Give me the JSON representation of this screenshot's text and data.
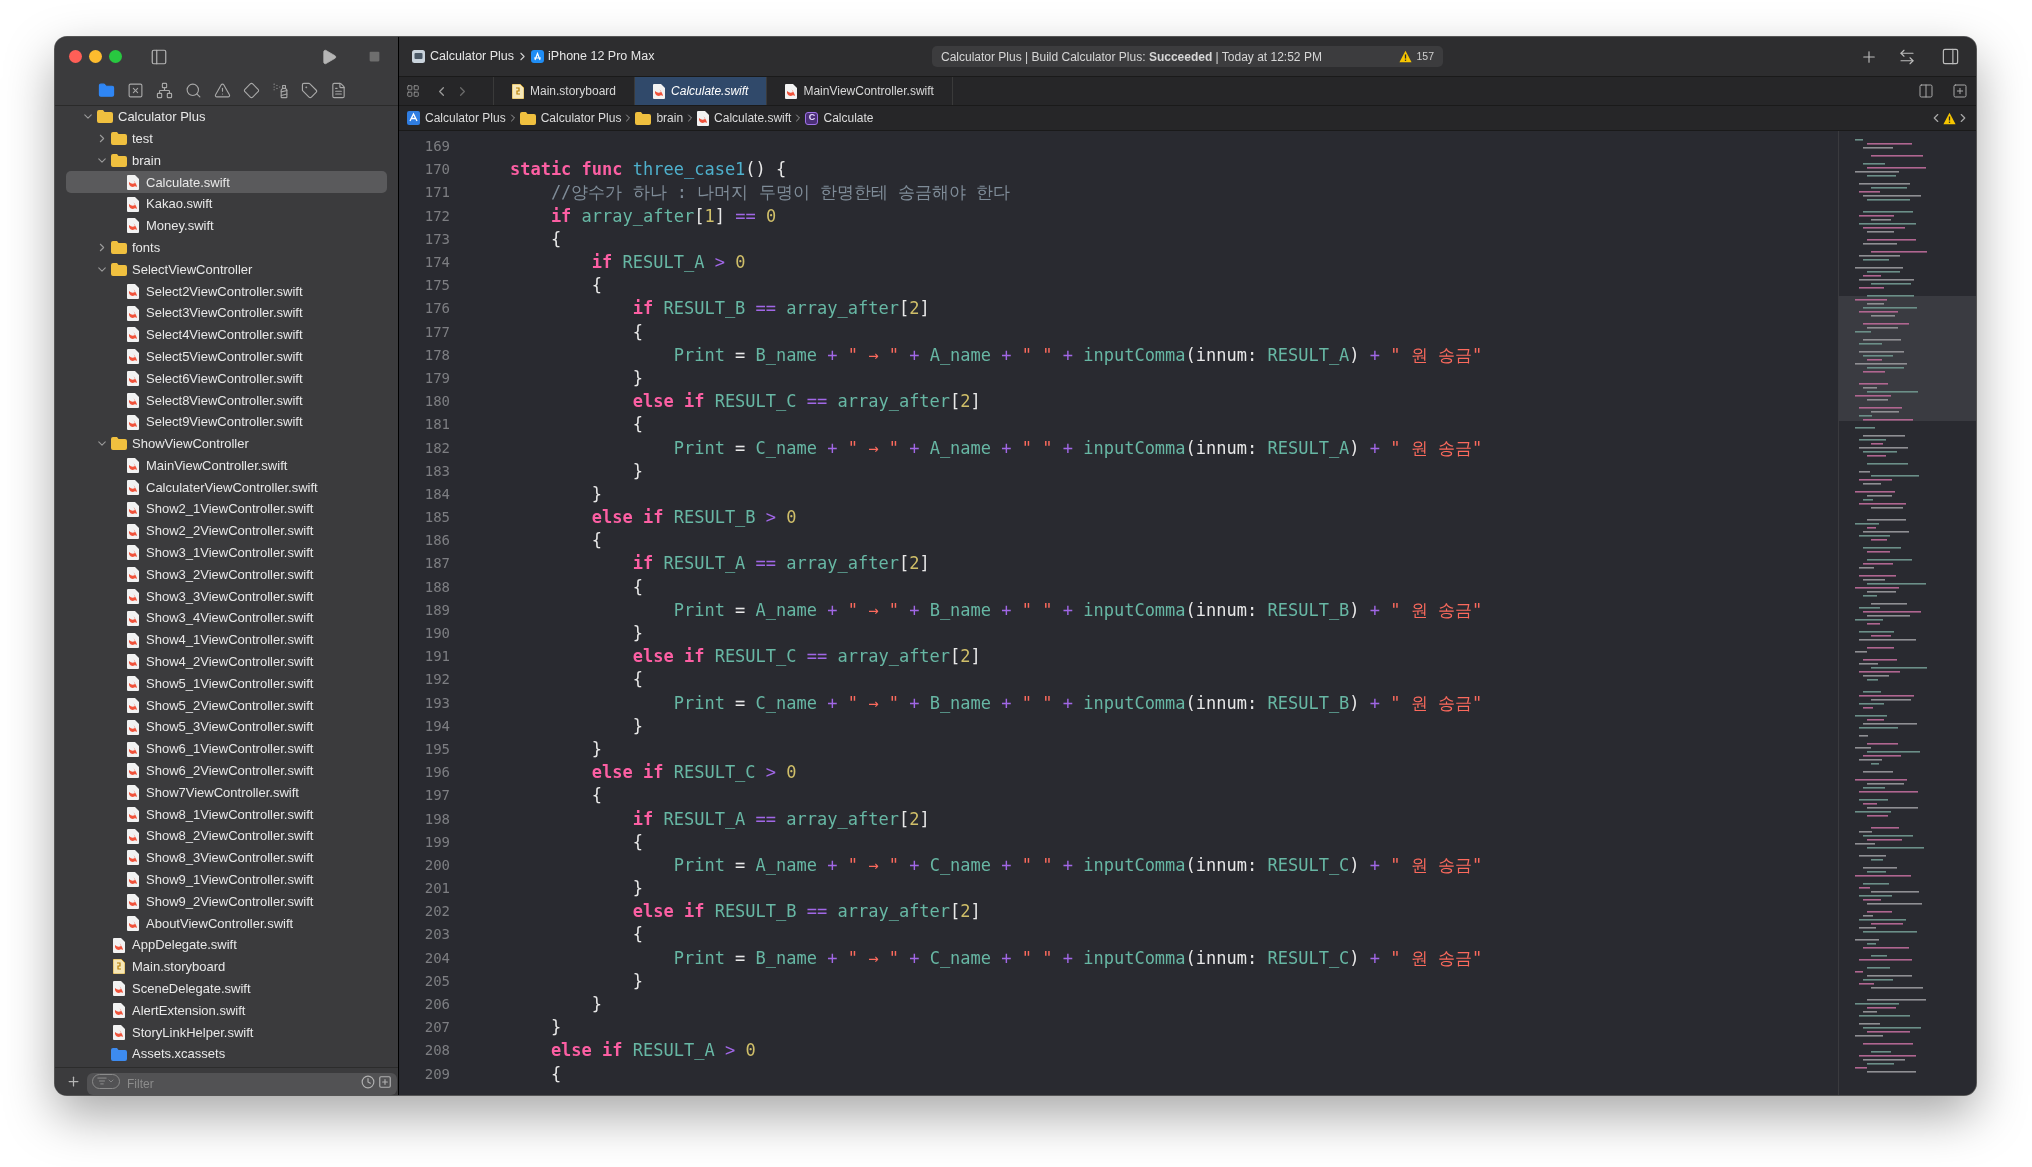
{
  "toolbar": {
    "scheme": "Calculator Plus",
    "destination": "iPhone 12 Pro Max",
    "activity": {
      "status": "Calculator Plus | Build Calculator Plus: **Succeeded** | Today at 12:52 PM",
      "warnings": "157"
    }
  },
  "navigator_tabs": [
    {
      "kind": "project",
      "selected": true
    },
    {
      "kind": "source_control",
      "selected": false
    },
    {
      "kind": "symbols",
      "selected": false
    },
    {
      "kind": "find",
      "selected": false
    },
    {
      "kind": "issues",
      "selected": false
    },
    {
      "kind": "tests",
      "selected": false
    },
    {
      "kind": "debug",
      "selected": false
    },
    {
      "kind": "breakpoints",
      "selected": false
    },
    {
      "kind": "reports",
      "selected": false
    }
  ],
  "sidebar": {
    "tree": [
      {
        "name": "Calculator Plus",
        "kind": "folder",
        "expanded": true,
        "selected": false,
        "children": [
          {
            "name": "test",
            "kind": "folder",
            "expanded": false,
            "selected": false
          },
          {
            "name": "brain",
            "kind": "folder",
            "expanded": true,
            "selected": false,
            "children": [
              {
                "name": "Calculate.swift",
                "kind": "swift",
                "selected": true
              },
              {
                "name": "Kakao.swift",
                "kind": "swift",
                "selected": false
              },
              {
                "name": "Money.swift",
                "kind": "swift",
                "selected": false
              }
            ]
          },
          {
            "name": "fonts",
            "kind": "folder",
            "expanded": false,
            "selected": false
          },
          {
            "name": "SelectViewController",
            "kind": "folder",
            "expanded": true,
            "selected": false,
            "children": [
              {
                "name": "Select2ViewController.swift",
                "kind": "swift",
                "selected": false
              },
              {
                "name": "Select3ViewController.swift",
                "kind": "swift",
                "selected": false
              },
              {
                "name": "Select4ViewController.swift",
                "kind": "swift",
                "selected": false
              },
              {
                "name": "Select5ViewController.swift",
                "kind": "swift",
                "selected": false
              },
              {
                "name": "Select6ViewController.swift",
                "kind": "swift",
                "selected": false
              },
              {
                "name": "Select8ViewController.swift",
                "kind": "swift",
                "selected": false
              },
              {
                "name": "Select9ViewController.swift",
                "kind": "swift",
                "selected": false
              }
            ]
          },
          {
            "name": "ShowViewController",
            "kind": "folder",
            "expanded": true,
            "selected": false,
            "children": [
              {
                "name": "MainViewController.swift",
                "kind": "swift",
                "selected": false
              },
              {
                "name": "CalculaterViewController.swift",
                "kind": "swift",
                "selected": false
              },
              {
                "name": "Show2_1ViewController.swift",
                "kind": "swift",
                "selected": false
              },
              {
                "name": "Show2_2ViewController.swift",
                "kind": "swift",
                "selected": false
              },
              {
                "name": "Show3_1ViewController.swift",
                "kind": "swift",
                "selected": false
              },
              {
                "name": "Show3_2ViewController.swift",
                "kind": "swift",
                "selected": false
              },
              {
                "name": "Show3_3ViewController.swift",
                "kind": "swift",
                "selected": false
              },
              {
                "name": "Show3_4ViewController.swift",
                "kind": "swift",
                "selected": false
              },
              {
                "name": "Show4_1ViewController.swift",
                "kind": "swift",
                "selected": false
              },
              {
                "name": "Show4_2ViewController.swift",
                "kind": "swift",
                "selected": false
              },
              {
                "name": "Show5_1ViewController.swift",
                "kind": "swift",
                "selected": false
              },
              {
                "name": "Show5_2ViewController.swift",
                "kind": "swift",
                "selected": false
              },
              {
                "name": "Show5_3ViewController.swift",
                "kind": "swift",
                "selected": false
              },
              {
                "name": "Show6_1ViewController.swift",
                "kind": "swift",
                "selected": false
              },
              {
                "name": "Show6_2ViewController.swift",
                "kind": "swift",
                "selected": false
              },
              {
                "name": "Show7ViewController.swift",
                "kind": "swift",
                "selected": false
              },
              {
                "name": "Show8_1ViewController.swift",
                "kind": "swift",
                "selected": false
              },
              {
                "name": "Show8_2ViewController.swift",
                "kind": "swift",
                "selected": false
              },
              {
                "name": "Show8_3ViewController.swift",
                "kind": "swift",
                "selected": false
              },
              {
                "name": "Show9_1ViewController.swift",
                "kind": "swift",
                "selected": false
              },
              {
                "name": "Show9_2ViewController.swift",
                "kind": "swift",
                "selected": false
              },
              {
                "name": "AboutViewController.swift",
                "kind": "swift",
                "selected": false
              }
            ]
          },
          {
            "name": "AppDelegate.swift",
            "kind": "swift",
            "selected": false
          },
          {
            "name": "Main.storyboard",
            "kind": "storyboard",
            "selected": false
          },
          {
            "name": "SceneDelegate.swift",
            "kind": "swift",
            "selected": false
          },
          {
            "name": "AlertExtension.swift",
            "kind": "swift",
            "selected": false
          },
          {
            "name": "StoryLinkHelper.swift",
            "kind": "swift",
            "selected": false
          },
          {
            "name": "Assets.xcassets",
            "kind": "assets",
            "selected": false
          }
        ]
      }
    ],
    "filter": {
      "placeholder": "Filter"
    }
  },
  "editor": {
    "tabs": [
      {
        "label": "Main.storyboard",
        "kind": "storyboard",
        "selected": false,
        "preview": false
      },
      {
        "label": "Calculate.swift",
        "kind": "swift",
        "selected": true,
        "preview": true
      },
      {
        "label": "MainViewController.swift",
        "kind": "swift",
        "selected": false,
        "preview": false
      }
    ],
    "jump_bar": [
      {
        "label": "Calculator Plus",
        "kind": "project"
      },
      {
        "label": "Calculator Plus",
        "kind": "folder"
      },
      {
        "label": "brain",
        "kind": "folder"
      },
      {
        "label": "Calculate.swift",
        "kind": "swift"
      },
      {
        "label": "Calculate",
        "kind": "class",
        "badge": "C"
      }
    ],
    "lines": [
      {
        "number": "169"
      },
      {
        "number": "170",
        "tokens": [
          {
            "kind": "keyword",
            "text": "    static func "
          },
          {
            "kind": "declaration",
            "text": "three_case1"
          },
          {
            "kind": "plain",
            "text": "() {"
          }
        ]
      },
      {
        "number": "171",
        "tokens": [
          {
            "kind": "comment",
            "text": "        //양수가 하나 : 나머지 두명이 한명한테 송금해야 한다"
          }
        ]
      },
      {
        "number": "172",
        "tokens": [
          {
            "kind": "keyword",
            "text": "        if "
          },
          {
            "kind": "name",
            "text": "array_after"
          },
          {
            "kind": "plain",
            "text": "["
          },
          {
            "kind": "number",
            "text": "1"
          },
          {
            "kind": "plain",
            "text": "] "
          },
          {
            "kind": "operator",
            "text": "== "
          },
          {
            "kind": "number",
            "text": "0"
          }
        ]
      },
      {
        "number": "173",
        "tokens": [
          {
            "kind": "plain",
            "text": "        {"
          }
        ]
      },
      {
        "number": "174",
        "tokens": [
          {
            "kind": "keyword",
            "text": "            if "
          },
          {
            "kind": "name",
            "text": "RESULT_A "
          },
          {
            "kind": "operator",
            "text": "> "
          },
          {
            "kind": "number",
            "text": "0"
          }
        ]
      },
      {
        "number": "175",
        "tokens": [
          {
            "kind": "plain",
            "text": "            {"
          }
        ]
      },
      {
        "number": "176",
        "tokens": [
          {
            "kind": "keyword",
            "text": "                if "
          },
          {
            "kind": "name",
            "text": "RESULT_B "
          },
          {
            "kind": "operator",
            "text": "== "
          },
          {
            "kind": "name",
            "text": "array_after"
          },
          {
            "kind": "plain",
            "text": "["
          },
          {
            "kind": "number",
            "text": "2"
          },
          {
            "kind": "plain",
            "text": "]"
          }
        ]
      },
      {
        "number": "177",
        "tokens": [
          {
            "kind": "plain",
            "text": "                {"
          }
        ]
      },
      {
        "number": "178",
        "tokens": [
          {
            "kind": "name",
            "text": "                    Print"
          },
          {
            "kind": "plain",
            "text": " = "
          },
          {
            "kind": "name",
            "text": "B_name "
          },
          {
            "kind": "operator",
            "text": "+ "
          },
          {
            "kind": "string",
            "text": "\" → \" "
          },
          {
            "kind": "operator",
            "text": "+ "
          },
          {
            "kind": "name",
            "text": "A_name "
          },
          {
            "kind": "operator",
            "text": "+ "
          },
          {
            "kind": "string",
            "text": "\" \" "
          },
          {
            "kind": "operator",
            "text": "+ "
          },
          {
            "kind": "name",
            "text": "inputComma"
          },
          {
            "kind": "plain",
            "text": "(innum: "
          },
          {
            "kind": "name",
            "text": "RESULT_A"
          },
          {
            "kind": "plain",
            "text": ") "
          },
          {
            "kind": "operator",
            "text": "+ "
          },
          {
            "kind": "string",
            "text": "\" 원 송금\""
          }
        ]
      },
      {
        "number": "179",
        "tokens": [
          {
            "kind": "plain",
            "text": "                }"
          }
        ]
      },
      {
        "number": "180",
        "tokens": [
          {
            "kind": "keyword",
            "text": "                else if "
          },
          {
            "kind": "name",
            "text": "RESULT_C "
          },
          {
            "kind": "operator",
            "text": "== "
          },
          {
            "kind": "name",
            "text": "array_after"
          },
          {
            "kind": "plain",
            "text": "["
          },
          {
            "kind": "number",
            "text": "2"
          },
          {
            "kind": "plain",
            "text": "]"
          }
        ]
      },
      {
        "number": "181",
        "tokens": [
          {
            "kind": "plain",
            "text": "                {"
          }
        ]
      },
      {
        "number": "182",
        "tokens": [
          {
            "kind": "name",
            "text": "                    Print"
          },
          {
            "kind": "plain",
            "text": " = "
          },
          {
            "kind": "name",
            "text": "C_name "
          },
          {
            "kind": "operator",
            "text": "+ "
          },
          {
            "kind": "string",
            "text": "\" → \" "
          },
          {
            "kind": "operator",
            "text": "+ "
          },
          {
            "kind": "name",
            "text": "A_name "
          },
          {
            "kind": "operator",
            "text": "+ "
          },
          {
            "kind": "string",
            "text": "\" \" "
          },
          {
            "kind": "operator",
            "text": "+ "
          },
          {
            "kind": "name",
            "text": "inputComma"
          },
          {
            "kind": "plain",
            "text": "(innum: "
          },
          {
            "kind": "name",
            "text": "RESULT_A"
          },
          {
            "kind": "plain",
            "text": ") "
          },
          {
            "kind": "operator",
            "text": "+ "
          },
          {
            "kind": "string",
            "text": "\" 원 송금\""
          }
        ]
      },
      {
        "number": "183",
        "tokens": [
          {
            "kind": "plain",
            "text": "                }"
          }
        ]
      },
      {
        "number": "184",
        "tokens": [
          {
            "kind": "plain",
            "text": "            }"
          }
        ]
      },
      {
        "number": "185",
        "tokens": [
          {
            "kind": "keyword",
            "text": "            else if "
          },
          {
            "kind": "name",
            "text": "RESULT_B "
          },
          {
            "kind": "operator",
            "text": "> "
          },
          {
            "kind": "number",
            "text": "0"
          }
        ]
      },
      {
        "number": "186",
        "tokens": [
          {
            "kind": "plain",
            "text": "            {"
          }
        ]
      },
      {
        "number": "187",
        "tokens": [
          {
            "kind": "keyword",
            "text": "                if "
          },
          {
            "kind": "name",
            "text": "RESULT_A "
          },
          {
            "kind": "operator",
            "text": "== "
          },
          {
            "kind": "name",
            "text": "array_after"
          },
          {
            "kind": "plain",
            "text": "["
          },
          {
            "kind": "number",
            "text": "2"
          },
          {
            "kind": "plain",
            "text": "]"
          }
        ]
      },
      {
        "number": "188",
        "tokens": [
          {
            "kind": "plain",
            "text": "                {"
          }
        ]
      },
      {
        "number": "189",
        "tokens": [
          {
            "kind": "name",
            "text": "                    Print"
          },
          {
            "kind": "plain",
            "text": " = "
          },
          {
            "kind": "name",
            "text": "A_name "
          },
          {
            "kind": "operator",
            "text": "+ "
          },
          {
            "kind": "string",
            "text": "\" → \" "
          },
          {
            "kind": "operator",
            "text": "+ "
          },
          {
            "kind": "name",
            "text": "B_name "
          },
          {
            "kind": "operator",
            "text": "+ "
          },
          {
            "kind": "string",
            "text": "\" \" "
          },
          {
            "kind": "operator",
            "text": "+ "
          },
          {
            "kind": "name",
            "text": "inputComma"
          },
          {
            "kind": "plain",
            "text": "(innum: "
          },
          {
            "kind": "name",
            "text": "RESULT_B"
          },
          {
            "kind": "plain",
            "text": ") "
          },
          {
            "kind": "operator",
            "text": "+ "
          },
          {
            "kind": "string",
            "text": "\" 원 송금\""
          }
        ]
      },
      {
        "number": "190",
        "tokens": [
          {
            "kind": "plain",
            "text": "                }"
          }
        ]
      },
      {
        "number": "191",
        "tokens": [
          {
            "kind": "keyword",
            "text": "                else if "
          },
          {
            "kind": "name",
            "text": "RESULT_C "
          },
          {
            "kind": "operator",
            "text": "== "
          },
          {
            "kind": "name",
            "text": "array_after"
          },
          {
            "kind": "plain",
            "text": "["
          },
          {
            "kind": "number",
            "text": "2"
          },
          {
            "kind": "plain",
            "text": "]"
          }
        ]
      },
      {
        "number": "192",
        "tokens": [
          {
            "kind": "plain",
            "text": "                {"
          }
        ]
      },
      {
        "number": "193",
        "tokens": [
          {
            "kind": "name",
            "text": "                    Print"
          },
          {
            "kind": "plain",
            "text": " = "
          },
          {
            "kind": "name",
            "text": "C_name "
          },
          {
            "kind": "operator",
            "text": "+ "
          },
          {
            "kind": "string",
            "text": "\" → \" "
          },
          {
            "kind": "operator",
            "text": "+ "
          },
          {
            "kind": "name",
            "text": "B_name "
          },
          {
            "kind": "operator",
            "text": "+ "
          },
          {
            "kind": "string",
            "text": "\" \" "
          },
          {
            "kind": "operator",
            "text": "+ "
          },
          {
            "kind": "name",
            "text": "inputComma"
          },
          {
            "kind": "plain",
            "text": "(innum: "
          },
          {
            "kind": "name",
            "text": "RESULT_B"
          },
          {
            "kind": "plain",
            "text": ") "
          },
          {
            "kind": "operator",
            "text": "+ "
          },
          {
            "kind": "string",
            "text": "\" 원 송금\""
          }
        ]
      },
      {
        "number": "194",
        "tokens": [
          {
            "kind": "plain",
            "text": "                }"
          }
        ]
      },
      {
        "number": "195",
        "tokens": [
          {
            "kind": "plain",
            "text": "            }"
          }
        ]
      },
      {
        "number": "196",
        "tokens": [
          {
            "kind": "keyword",
            "text": "            else if "
          },
          {
            "kind": "name",
            "text": "RESULT_C "
          },
          {
            "kind": "operator",
            "text": "> "
          },
          {
            "kind": "number",
            "text": "0"
          }
        ]
      },
      {
        "number": "197",
        "tokens": [
          {
            "kind": "plain",
            "text": "            {"
          }
        ]
      },
      {
        "number": "198",
        "tokens": [
          {
            "kind": "keyword",
            "text": "                if "
          },
          {
            "kind": "name",
            "text": "RESULT_A "
          },
          {
            "kind": "operator",
            "text": "== "
          },
          {
            "kind": "name",
            "text": "array_after"
          },
          {
            "kind": "plain",
            "text": "["
          },
          {
            "kind": "number",
            "text": "2"
          },
          {
            "kind": "plain",
            "text": "]"
          }
        ]
      },
      {
        "number": "199",
        "tokens": [
          {
            "kind": "plain",
            "text": "                {"
          }
        ]
      },
      {
        "number": "200",
        "tokens": [
          {
            "kind": "name",
            "text": "                    Print"
          },
          {
            "kind": "plain",
            "text": " = "
          },
          {
            "kind": "name",
            "text": "A_name "
          },
          {
            "kind": "operator",
            "text": "+ "
          },
          {
            "kind": "string",
            "text": "\" → \" "
          },
          {
            "kind": "operator",
            "text": "+ "
          },
          {
            "kind": "name",
            "text": "C_name "
          },
          {
            "kind": "operator",
            "text": "+ "
          },
          {
            "kind": "string",
            "text": "\" \" "
          },
          {
            "kind": "operator",
            "text": "+ "
          },
          {
            "kind": "name",
            "text": "inputComma"
          },
          {
            "kind": "plain",
            "text": "(innum: "
          },
          {
            "kind": "name",
            "text": "RESULT_C"
          },
          {
            "kind": "plain",
            "text": ") "
          },
          {
            "kind": "operator",
            "text": "+ "
          },
          {
            "kind": "string",
            "text": "\" 원 송금\""
          }
        ]
      },
      {
        "number": "201",
        "tokens": [
          {
            "kind": "plain",
            "text": "                }"
          }
        ]
      },
      {
        "number": "202",
        "tokens": [
          {
            "kind": "keyword",
            "text": "                else if "
          },
          {
            "kind": "name",
            "text": "RESULT_B "
          },
          {
            "kind": "operator",
            "text": "== "
          },
          {
            "kind": "name",
            "text": "array_after"
          },
          {
            "kind": "plain",
            "text": "["
          },
          {
            "kind": "number",
            "text": "2"
          },
          {
            "kind": "plain",
            "text": "]"
          }
        ]
      },
      {
        "number": "203",
        "tokens": [
          {
            "kind": "plain",
            "text": "                {"
          }
        ]
      },
      {
        "number": "204",
        "tokens": [
          {
            "kind": "name",
            "text": "                    Print"
          },
          {
            "kind": "plain",
            "text": " = "
          },
          {
            "kind": "name",
            "text": "B_name "
          },
          {
            "kind": "operator",
            "text": "+ "
          },
          {
            "kind": "string",
            "text": "\" → \" "
          },
          {
            "kind": "operator",
            "text": "+ "
          },
          {
            "kind": "name",
            "text": "C_name "
          },
          {
            "kind": "operator",
            "text": "+ "
          },
          {
            "kind": "string",
            "text": "\" \" "
          },
          {
            "kind": "operator",
            "text": "+ "
          },
          {
            "kind": "name",
            "text": "inputComma"
          },
          {
            "kind": "plain",
            "text": "(innum: "
          },
          {
            "kind": "name",
            "text": "RESULT_C"
          },
          {
            "kind": "plain",
            "text": ") "
          },
          {
            "kind": "operator",
            "text": "+ "
          },
          {
            "kind": "string",
            "text": "\" 원 송금\""
          }
        ]
      },
      {
        "number": "205",
        "tokens": [
          {
            "kind": "plain",
            "text": "                }"
          }
        ]
      },
      {
        "number": "206",
        "tokens": [
          {
            "kind": "plain",
            "text": "            }"
          }
        ]
      },
      {
        "number": "207",
        "tokens": [
          {
            "kind": "plain",
            "text": "        }"
          }
        ]
      },
      {
        "number": "208",
        "tokens": [
          {
            "kind": "keyword",
            "text": "        else if "
          },
          {
            "kind": "name",
            "text": "RESULT_A "
          },
          {
            "kind": "operator",
            "text": "> "
          },
          {
            "kind": "number",
            "text": "0"
          }
        ]
      },
      {
        "number": "209",
        "tokens": [
          {
            "kind": "plain",
            "text": "        {"
          }
        ]
      }
    ]
  }
}
